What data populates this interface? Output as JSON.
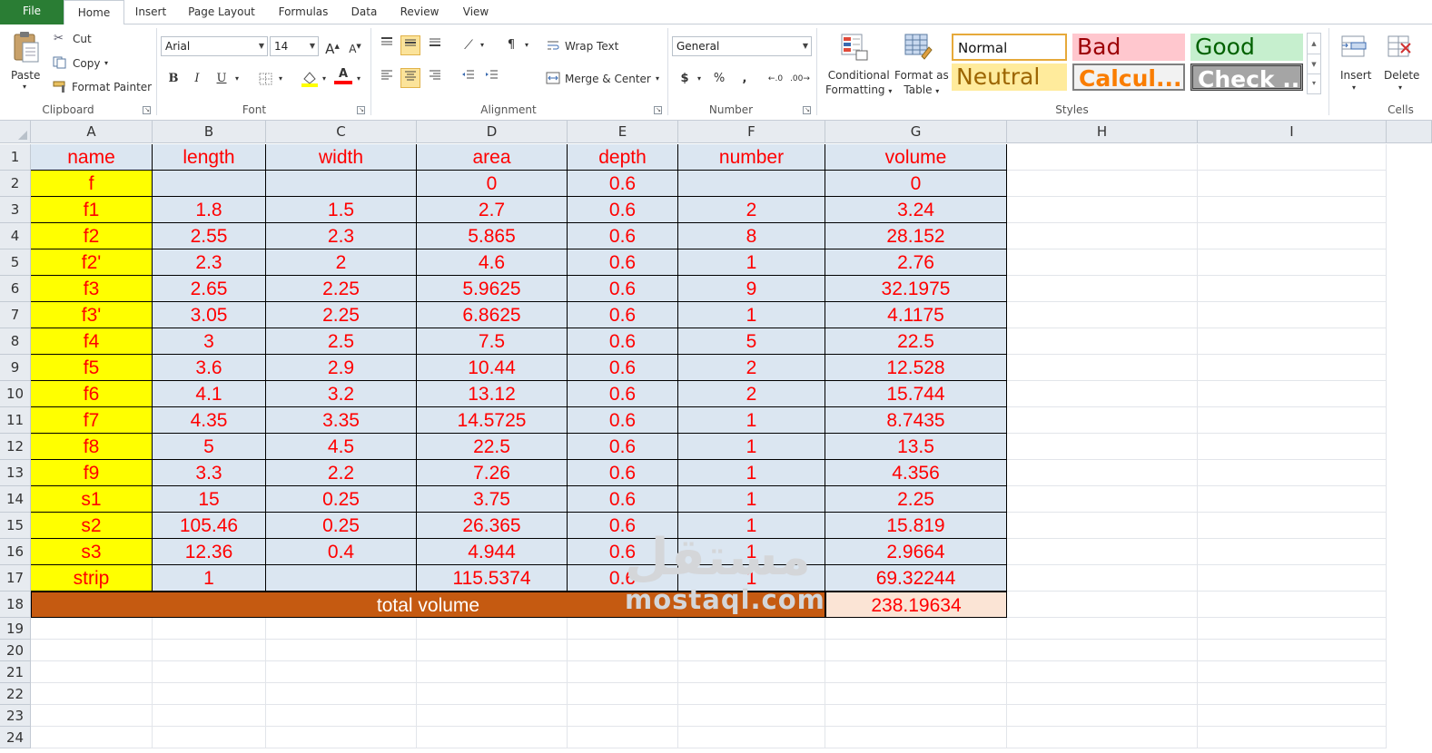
{
  "tabs": {
    "file": "File",
    "items": [
      "Home",
      "Insert",
      "Page Layout",
      "Formulas",
      "Data",
      "Review",
      "View"
    ],
    "active": "Home"
  },
  "ribbon": {
    "clipboard": {
      "label": "Clipboard",
      "paste": "Paste",
      "cut": "Cut",
      "copy": "Copy",
      "format_painter": "Format Painter"
    },
    "font": {
      "label": "Font",
      "family": "Arial",
      "size": "14",
      "grow": "A",
      "shrink": "A",
      "bold": "B",
      "italic": "I",
      "underline": "U",
      "font_color_glyph": "A",
      "fill_color": "#ffff00",
      "font_color": "#ff0000"
    },
    "alignment": {
      "label": "Alignment",
      "wrap_text": "Wrap Text",
      "merge_center": "Merge & Center"
    },
    "number": {
      "label": "Number",
      "format": "General",
      "currency": "$",
      "percent": "%",
      "comma": ","
    },
    "styles": {
      "label": "Styles",
      "conditional": [
        "Conditional",
        "Formatting"
      ],
      "format_table": [
        "Format as",
        "Table"
      ],
      "gallery": [
        {
          "key": "normal",
          "label": "Normal"
        },
        {
          "key": "bad",
          "label": "Bad"
        },
        {
          "key": "good",
          "label": "Good"
        },
        {
          "key": "neutral",
          "label": "Neutral"
        },
        {
          "key": "calc",
          "label": "Calcul..."
        },
        {
          "key": "check",
          "label": "Check ..."
        }
      ]
    },
    "cells": {
      "label": "Cells",
      "insert": "Insert",
      "delete": "Delete"
    }
  },
  "grid": {
    "columns": [
      "A",
      "B",
      "C",
      "D",
      "E",
      "F",
      "G",
      "H",
      "I"
    ],
    "rows": [
      "1",
      "2",
      "3",
      "4",
      "5",
      "6",
      "7",
      "8",
      "9",
      "10",
      "11",
      "12",
      "13",
      "14",
      "15",
      "16",
      "17",
      "18",
      "19",
      "20",
      "21",
      "22",
      "23",
      "24"
    ],
    "headers": [
      "name",
      "length",
      "width",
      "area",
      "depth",
      "number",
      "volume"
    ],
    "data": [
      [
        "f",
        "",
        "",
        "0",
        "0.6",
        "",
        "0"
      ],
      [
        "f1",
        "1.8",
        "1.5",
        "2.7",
        "0.6",
        "2",
        "3.24"
      ],
      [
        "f2",
        "2.55",
        "2.3",
        "5.865",
        "0.6",
        "8",
        "28.152"
      ],
      [
        "f2'",
        "2.3",
        "2",
        "4.6",
        "0.6",
        "1",
        "2.76"
      ],
      [
        "f3",
        "2.65",
        "2.25",
        "5.9625",
        "0.6",
        "9",
        "32.1975"
      ],
      [
        "f3'",
        "3.05",
        "2.25",
        "6.8625",
        "0.6",
        "1",
        "4.1175"
      ],
      [
        "f4",
        "3",
        "2.5",
        "7.5",
        "0.6",
        "5",
        "22.5"
      ],
      [
        "f5",
        "3.6",
        "2.9",
        "10.44",
        "0.6",
        "2",
        "12.528"
      ],
      [
        "f6",
        "4.1",
        "3.2",
        "13.12",
        "0.6",
        "2",
        "15.744"
      ],
      [
        "f7",
        "4.35",
        "3.35",
        "14.5725",
        "0.6",
        "1",
        "8.7435"
      ],
      [
        "f8",
        "5",
        "4.5",
        "22.5",
        "0.6",
        "1",
        "13.5"
      ],
      [
        "f9",
        "3.3",
        "2.2",
        "7.26",
        "0.6",
        "1",
        "4.356"
      ],
      [
        "s1",
        "15",
        "0.25",
        "3.75",
        "0.6",
        "1",
        "2.25"
      ],
      [
        "s2",
        "105.46",
        "0.25",
        "26.365",
        "0.6",
        "1",
        "15.819"
      ],
      [
        "s3",
        "12.36",
        "0.4",
        "4.944",
        "0.6",
        "1",
        "2.9664"
      ],
      [
        "strip",
        "1",
        "",
        "115.5374",
        "0.6",
        "1",
        "69.32244"
      ]
    ],
    "total_label": "total volume",
    "total_value": "238.19634"
  },
  "watermark": {
    "arabic": "مستقل",
    "latin": "mostaql.com"
  }
}
